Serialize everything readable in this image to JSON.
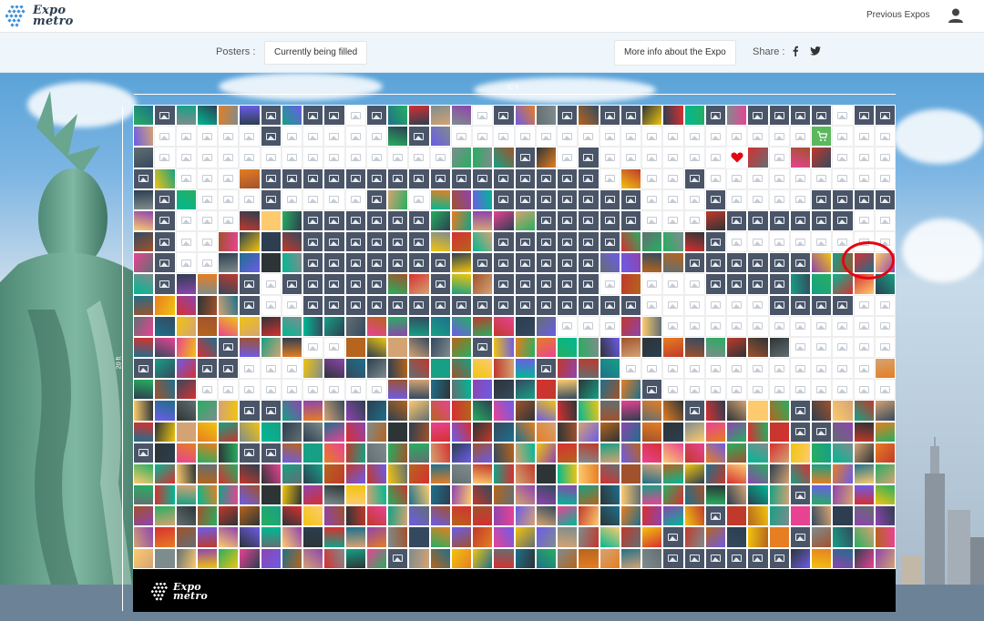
{
  "brand": {
    "name_line1": "Expo",
    "name_line2": "metro"
  },
  "nav": {
    "previous_expos": "Previous Expos"
  },
  "subbar": {
    "posters_label": "Posters :",
    "posters_status": "Currently being filled",
    "more_info": "More info about the Expo",
    "share_label": "Share :"
  },
  "wall": {
    "width_label": "30 ft",
    "height_label": "20 ft",
    "columns": 36,
    "rows": 22,
    "heart_color": "#e30613",
    "cart_color": "#5cb85c",
    "placeholder_color": "#4a5568"
  },
  "icons": {
    "logo": "grid-logo-icon",
    "user": "user-icon",
    "facebook": "facebook-icon",
    "twitter": "twitter-icon",
    "placeholder": "image-placeholder-icon",
    "cart": "cart-icon",
    "heart": "heart-icon"
  }
}
